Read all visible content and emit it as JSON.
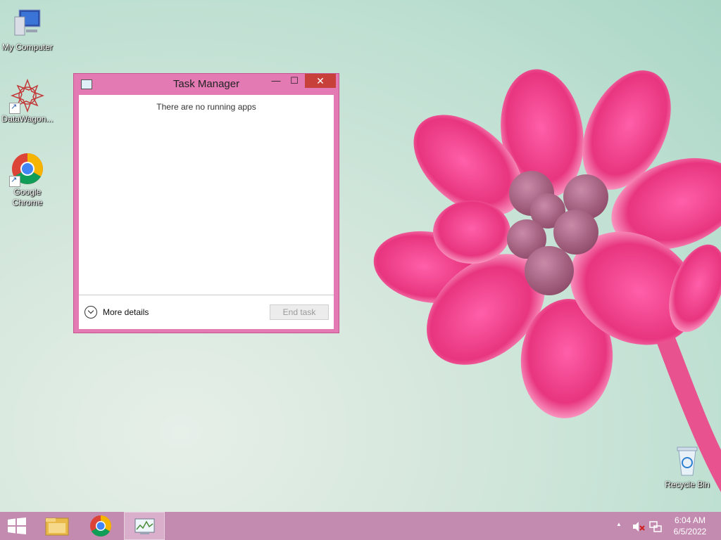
{
  "desktop": {
    "icons": [
      {
        "label": "My Computer"
      },
      {
        "label": "DataWagon..."
      },
      {
        "label": "Google Chrome"
      },
      {
        "label": "Recycle Bin"
      }
    ]
  },
  "task_manager": {
    "title": "Task Manager",
    "minimize": "—",
    "maximize": "☐",
    "close": "✕",
    "empty_message": "There are no running apps",
    "more_details": "More details",
    "end_task": "End task"
  },
  "taskbar": {
    "clock_time": "6:04 AM",
    "clock_date": "6/5/2022",
    "tray_chevron": "▲"
  },
  "colors": {
    "window_frame": "#e37ab4",
    "close_button": "#c7403a",
    "taskbar": "#c38bb0"
  }
}
